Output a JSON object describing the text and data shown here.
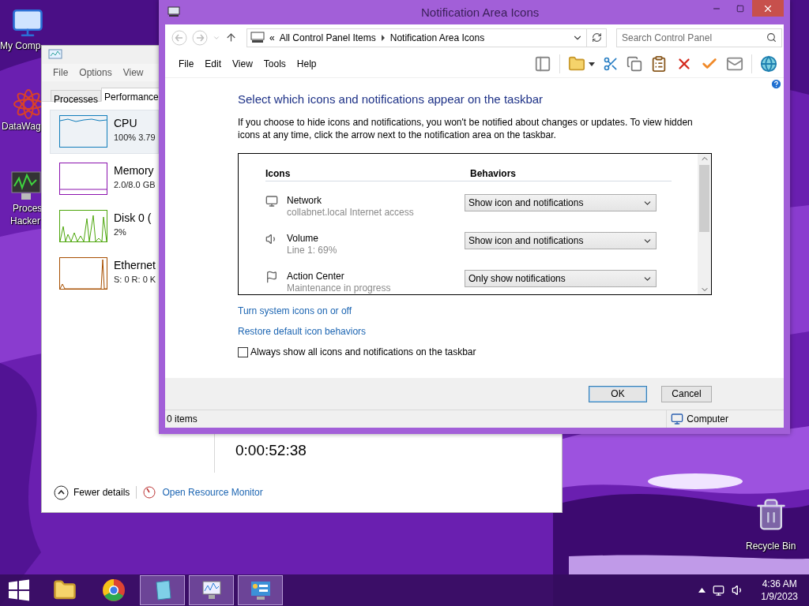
{
  "desktop_icons": [
    {
      "kind": "computer",
      "lines": [
        "My Comp"
      ]
    },
    {
      "kind": "flower",
      "lines": [
        "DataWag"
      ]
    },
    {
      "kind": "monitor",
      "lines": [
        "Proces",
        "Hacker"
      ]
    }
  ],
  "recycle_bin": {
    "label": "Recycle Bin"
  },
  "task_manager": {
    "menu": [
      "File",
      "Options",
      "View"
    ],
    "tabs": [
      {
        "label": "Processes",
        "selected": false
      },
      {
        "label": "Performance",
        "selected": true
      }
    ],
    "resources": [
      {
        "name": "CPU",
        "detail": "100% 3.79",
        "selected": true,
        "color": "#117dbb"
      },
      {
        "name": "Memory",
        "detail": "2.0/8.0 GB",
        "selected": false,
        "color": "#8b12ae"
      },
      {
        "name": "Disk 0 (",
        "detail": "2%",
        "selected": false,
        "color": "#4da60c"
      },
      {
        "name": "Ethernet",
        "detail": "S: 0 R: 0 K",
        "selected": false,
        "color": "#a74f01"
      }
    ],
    "uptime": "0:00:52:38",
    "fewer_details": "Fewer details",
    "resource_monitor_link": "Open Resource Monitor"
  },
  "window": {
    "title": "Notification Area Icons",
    "breadcrumb": [
      "All Control Panel Items",
      "Notification Area Icons"
    ],
    "breadcrumb_overflow": "«",
    "search": {
      "placeholder": "Search Control Panel"
    },
    "menu": [
      "File",
      "Edit",
      "View",
      "Tools",
      "Help"
    ],
    "heading": "Select which icons and notifications appear on the taskbar",
    "description": "If you choose to hide icons and notifications, you won't be notified about changes or updates. To view hidden icons at any time, click the arrow next to the notification area on the taskbar.",
    "table": {
      "columns": [
        "Icons",
        "Behaviors"
      ],
      "rows": [
        {
          "kind": "network",
          "name": "Network",
          "detail": "collabnet.local Internet access",
          "behavior": "Show icon and notifications"
        },
        {
          "kind": "volume",
          "name": "Volume",
          "detail": "Line 1: 69%",
          "behavior": "Show icon and notifications"
        },
        {
          "kind": "flag",
          "name": "Action Center",
          "detail": "Maintenance in progress",
          "behavior": "Only show notifications"
        }
      ]
    },
    "links": [
      "Turn system icons on or off",
      "Restore default icon behaviors"
    ],
    "checkbox": {
      "label": "Always show all icons and notifications on the taskbar",
      "checked": false
    },
    "buttons": [
      {
        "label": "OK",
        "default": true
      },
      {
        "label": "Cancel",
        "default": false
      }
    ],
    "status_bar": {
      "items": "0 items",
      "location": "Computer"
    }
  },
  "taskbar": {
    "apps": [
      {
        "kind": "explorer",
        "running": false
      },
      {
        "kind": "chrome",
        "running": false
      },
      {
        "kind": "notebook",
        "running": true
      },
      {
        "kind": "taskmgr",
        "running": true
      },
      {
        "kind": "control",
        "running": true
      }
    ],
    "time": "4:36 AM",
    "date": "1/9/2023"
  }
}
